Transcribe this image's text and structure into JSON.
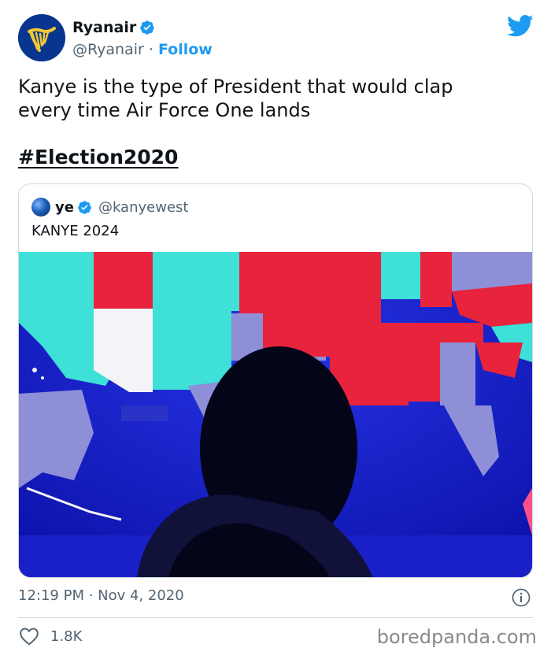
{
  "author": {
    "display_name": "Ryanair",
    "handle": "@Ryanair",
    "separator": " · ",
    "follow_label": "Follow"
  },
  "tweet": {
    "text_line1": "Kanye is the type of President that would clap",
    "text_line2": "every time Air Force One lands",
    "hashtag": "#Election2020"
  },
  "quoted_tweet": {
    "display_name": "ye",
    "handle": "@kanyewest",
    "text": "KANYE 2024",
    "image_subject": "election-map-with-silhouette"
  },
  "footer": {
    "timestamp": "12:19 PM · Nov 4, 2020",
    "like_count": "1.8K"
  },
  "watermark": "boredpanda.com",
  "colors": {
    "twitter_blue": "#1d9bf0",
    "brand_navy": "#073590",
    "brand_gold": "#f1c933",
    "map_red": "#e8233c",
    "map_teal": "#3ee0d8",
    "map_blue": "#1a1fd0"
  },
  "icons": {
    "twitter": "twitter-bird-icon",
    "verified": "verified-badge-icon",
    "info": "info-icon",
    "like": "heart-icon"
  }
}
